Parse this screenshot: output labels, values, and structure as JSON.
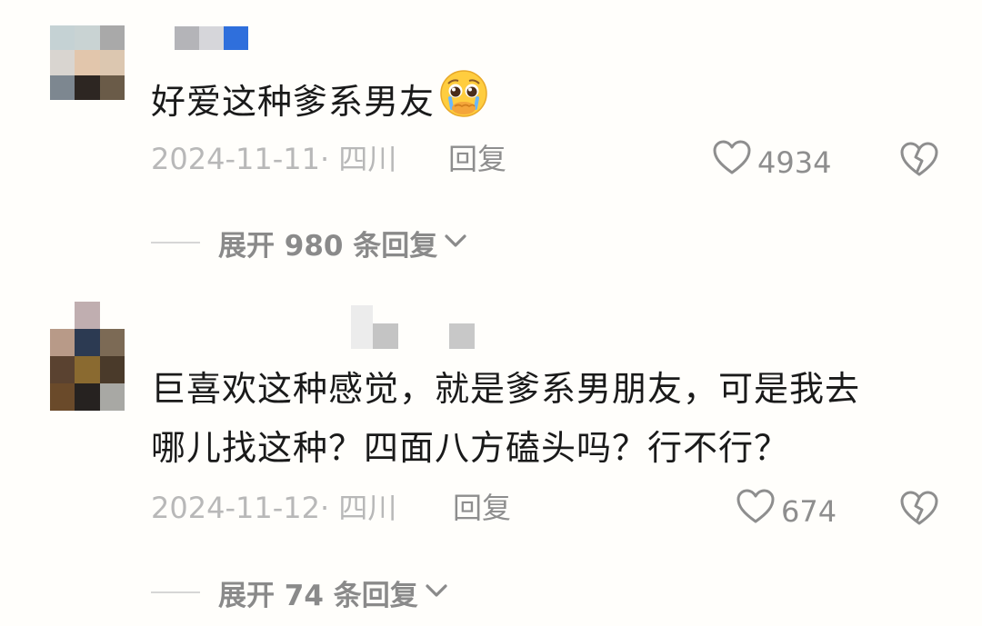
{
  "comments": [
    {
      "text_lines": [
        "好爱这种爹系男友"
      ],
      "emoji": "pleading-face-emoji",
      "date_location": "2024-11-11· 四川",
      "reply_label": "回复",
      "like_count": "4934",
      "expand_label": "展开 980 条回复"
    },
    {
      "text_lines": [
        "巨喜欢这种感觉，就是爹系男朋友，可是我去",
        "哪儿找这种？四面八方磕头吗？行不行？"
      ],
      "date_location": "2024-11-12· 四川",
      "reply_label": "回复",
      "like_count": "674",
      "expand_label": "展开 74 条回复"
    }
  ],
  "icons": {
    "like": "heart-outline-icon",
    "dislike": "broken-heart-icon",
    "expand": "chevron-down-icon"
  },
  "colors": {
    "background": "#fffefb",
    "text": "#1a1a1a",
    "meta": "#b8b8b8",
    "action": "#8e8e8e"
  }
}
